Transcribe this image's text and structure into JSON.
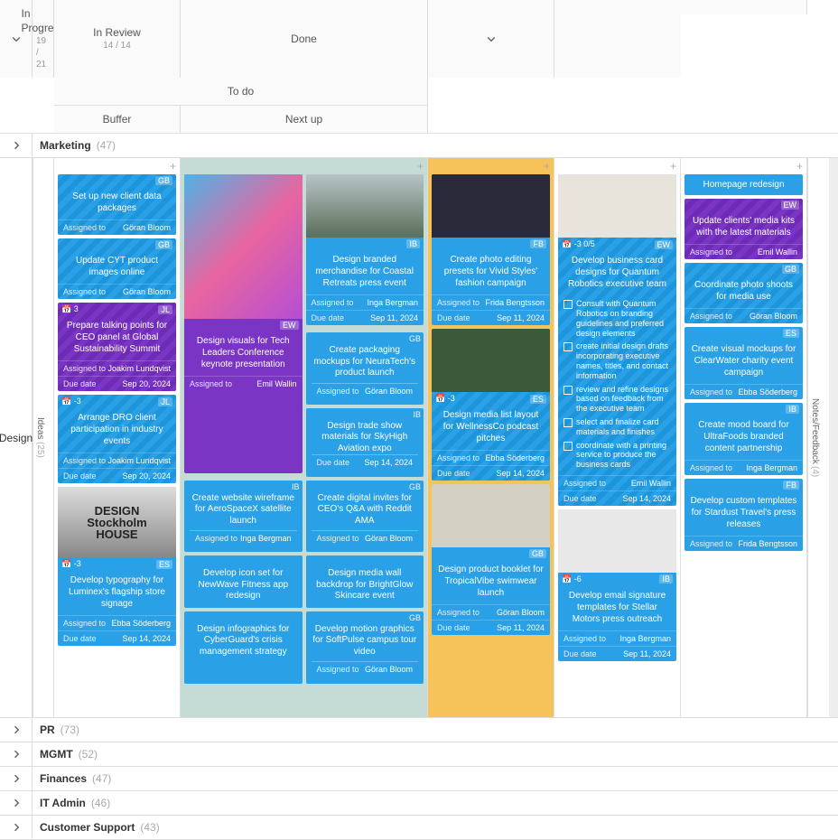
{
  "header": {
    "todo": "To do",
    "buffer": "Buffer",
    "nextup": "Next up",
    "inprogress": {
      "label": "In Progress",
      "count": "19 / 21"
    },
    "inreview": {
      "label": "In Review",
      "count": "14 / 14"
    },
    "done": "Done"
  },
  "side": {
    "ideas": {
      "label": "Ideas",
      "count": "(25)"
    },
    "notes": {
      "label": "Notes/Feedback",
      "count": "(4)"
    }
  },
  "lanes": {
    "marketing": {
      "name": "Marketing",
      "count": "(47)"
    },
    "design": {
      "name": "Design"
    },
    "pr": {
      "name": "PR",
      "count": "(73)"
    },
    "mgmt": {
      "name": "MGMT",
      "count": "(52)"
    },
    "finances": {
      "name": "Finances",
      "count": "(47)"
    },
    "it": {
      "name": "IT Admin",
      "count": "(46)"
    },
    "cs": {
      "name": "Customer Support",
      "count": "(43)"
    }
  },
  "labels": {
    "assigned": "Assigned to",
    "due": "Due date"
  },
  "buffer": [
    {
      "title": "Set up new client data packages",
      "assignee": "Göran Bloom",
      "tag": "GB",
      "striped": true
    },
    {
      "title": "Update CYT product images online",
      "assignee": "Göran Bloom",
      "tag": "GB",
      "striped": true
    },
    {
      "title": "Prepare talking points for CEO panel at Global Sustainability Summit",
      "assignee": "Joakim Lundqvist",
      "tag": "JL",
      "due": "Sep 20, 2024",
      "purple": true,
      "striped": true,
      "tl": "3"
    },
    {
      "title": "Arrange DRO client participation in industry events",
      "assignee": "Joakim Lundqvist",
      "tag": "JL",
      "due": "Sep 20, 2024",
      "striped": true,
      "tl": "-3"
    },
    {
      "img": "bw",
      "imgtext": "DESIGN\nStockholm\nHOUSE",
      "title": "Develop typography for Luminex's flagship store signage",
      "assignee": "Ebba Söderberg",
      "tag": "ES",
      "due": "Sep 14, 2024",
      "tl": "-3"
    }
  ],
  "nextup": [
    {
      "img": "paint",
      "span2": false,
      "title": "Design visuals for Tech Leaders Conference keynote presentation",
      "assignee": "Emil Wallin",
      "tag": "EW",
      "purple": true
    },
    {
      "img": "house",
      "title": "Design branded merchandise for Coastal Retreats press event",
      "assignee": "Inga Bergman",
      "tag": "IB",
      "due": "Sep 11, 2024"
    },
    {
      "title": "Create packaging mockups for NeuraTech's product launch",
      "assignee": "Göran Bloom",
      "tag": "GB"
    },
    {
      "title": "Design trade show materials for SkyHigh Aviation expo",
      "due": "Sep 14, 2024",
      "tag": "IB"
    },
    {
      "title": "Create website wireframe for AeroSpaceX satellite launch",
      "assignee": "Inga Bergman",
      "tag": "IB"
    },
    {
      "title": "Create digital invites for CEO's Q&A with Reddit AMA",
      "assignee": "Göran Bloom",
      "tag": "GB"
    },
    {
      "title": "Develop icon set for NewWave Fitness app redesign",
      "small": true
    },
    {
      "title": "Design media wall backdrop for BrightGlow Skincare event",
      "small": true
    },
    {
      "title": "Design infographics for CyberGuard's crisis management strategy",
      "small": true
    },
    {
      "title": "Develop motion graphics for SoftPulse campus tour video",
      "assignee": "Göran Bloom",
      "tag": "GB"
    }
  ],
  "inprogress": [
    {
      "img": "dash",
      "title": "Create photo editing presets for Vivid Styles' fashion campaign",
      "assignee": "Frida Bengtsson",
      "tag": "FB",
      "due": "Sep 11, 2024"
    },
    {
      "img": "veg",
      "title": "Design media list layout for WellnessCo podcast pitches",
      "assignee": "Ebba Söderberg",
      "tag": "ES",
      "due": "Sep 14, 2024",
      "striped": true,
      "tl": "-3"
    },
    {
      "img": "pine",
      "title": "Design product booklet for TropicalVibe swimwear launch",
      "assignee": "Göran Bloom",
      "tag": "GB",
      "due": "Sep 11, 2024"
    }
  ],
  "inreview": [
    {
      "img": "card-hand",
      "title": "Develop business card designs for Quantum Robotics executive team",
      "assignee": "Emil Wallin",
      "tag": "EW",
      "due": "Sep 14, 2024",
      "striped": true,
      "tl": "-3  0/5",
      "checklist": [
        "Consult with Quantum Robotics on branding guidelines and preferred design elements",
        "create initial design drafts incorporating executive names, titles, and contact information",
        "review and refine designs based on feedback from the executive team",
        "select and finalize card materials and finishes",
        "coordinate with a printing service to produce the business cards"
      ]
    },
    {
      "img": "van",
      "title": "Develop email signature templates for Stellar Motors press outreach",
      "assignee": "Inga Bergman",
      "tag": "IB",
      "due": "Sep 11, 2024",
      "tl": "-6"
    }
  ],
  "done": [
    {
      "title": "Homepage redesign",
      "slim": true
    },
    {
      "title": "Update clients' media kits with the latest materials",
      "assignee": "Emil Wallin",
      "tag": "EW",
      "purple": true,
      "striped": true
    },
    {
      "title": "Coordinate photo shoots for media use",
      "assignee": "Göran Bloom",
      "tag": "GB",
      "striped": true
    },
    {
      "title": "Create visual mockups for ClearWater charity event campaign",
      "assignee": "Ebba Söderberg",
      "tag": "ES"
    },
    {
      "title": "Create mood board for UltraFoods branded content partnership",
      "assignee": "Inga Bergman",
      "tag": "IB"
    },
    {
      "title": "Develop custom templates for Stardust Travel's press releases",
      "assignee": "Frida Bengtsson",
      "tag": "FB"
    }
  ]
}
